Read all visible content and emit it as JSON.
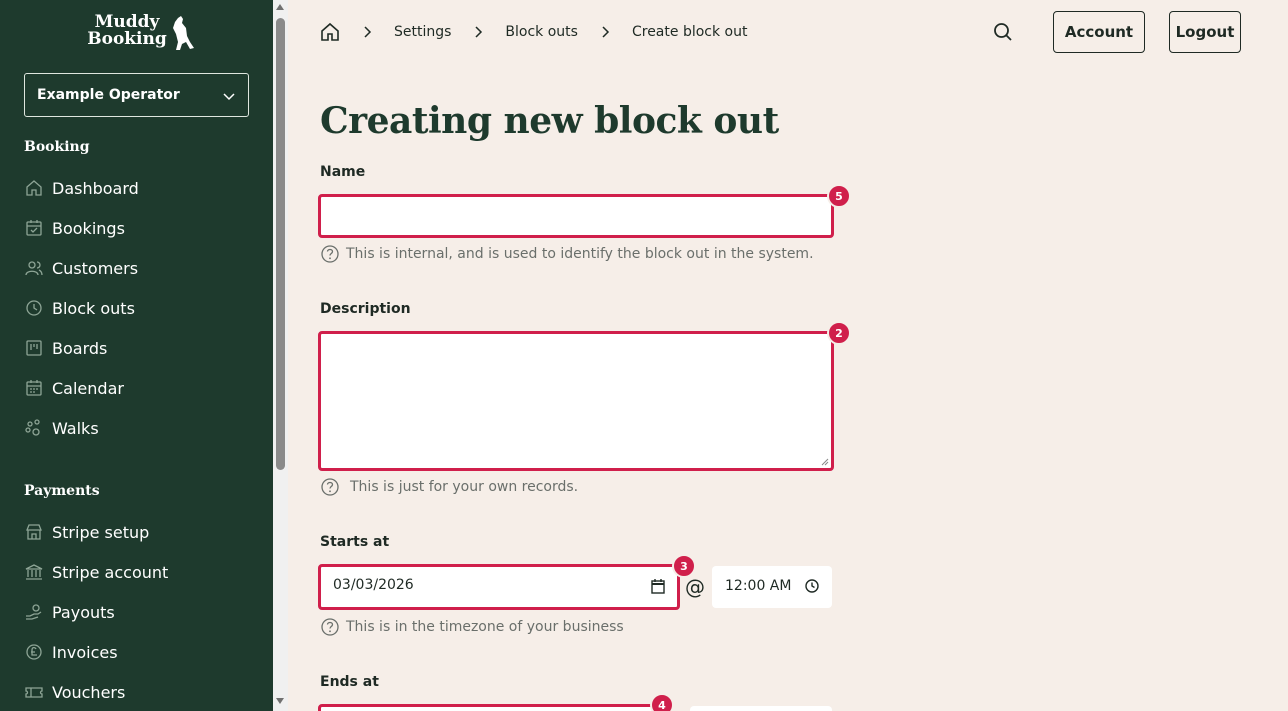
{
  "brand": {
    "logo_line1": "Muddy",
    "logo_line2": "Booking"
  },
  "operator_select": {
    "value": "Example Operator"
  },
  "sidebar": {
    "booking_title": "Booking",
    "booking_items": [
      {
        "label": "Dashboard",
        "icon": "home-icon"
      },
      {
        "label": "Bookings",
        "icon": "calendar-check-icon"
      },
      {
        "label": "Customers",
        "icon": "users-icon"
      },
      {
        "label": "Block outs",
        "icon": "clock-icon"
      },
      {
        "label": "Boards",
        "icon": "board-icon"
      },
      {
        "label": "Calendar",
        "icon": "calendar-icon"
      },
      {
        "label": "Walks",
        "icon": "paw-icon"
      }
    ],
    "payments_title": "Payments",
    "payments_items": [
      {
        "label": "Stripe setup",
        "icon": "store-icon"
      },
      {
        "label": "Stripe account",
        "icon": "bank-icon"
      },
      {
        "label": "Payouts",
        "icon": "payout-icon"
      },
      {
        "label": "Invoices",
        "icon": "pound-icon"
      },
      {
        "label": "Vouchers",
        "icon": "ticket-icon"
      }
    ]
  },
  "breadcrumb": [
    "Settings",
    "Block outs",
    "Create block out"
  ],
  "header": {
    "account_label": "Account",
    "logout_label": "Logout"
  },
  "page": {
    "title": "Creating new block out"
  },
  "form": {
    "name": {
      "label": "Name",
      "value": "",
      "help": "This is internal, and is used to identify the block out in the system.",
      "badge": "5"
    },
    "description": {
      "label": "Description",
      "value": "",
      "help": "This is just for your own records.",
      "badge": "2"
    },
    "starts_at": {
      "label": "Starts at",
      "date": "03/03/2026",
      "time": "12:00 AM",
      "help": "This is in the timezone of your business",
      "badge": "3",
      "at": "@"
    },
    "ends_at": {
      "label": "Ends at",
      "badge": "4"
    }
  },
  "colors": {
    "sidebar": "#1e3a2d",
    "background": "#f6eee8",
    "error": "#d01f4b"
  }
}
